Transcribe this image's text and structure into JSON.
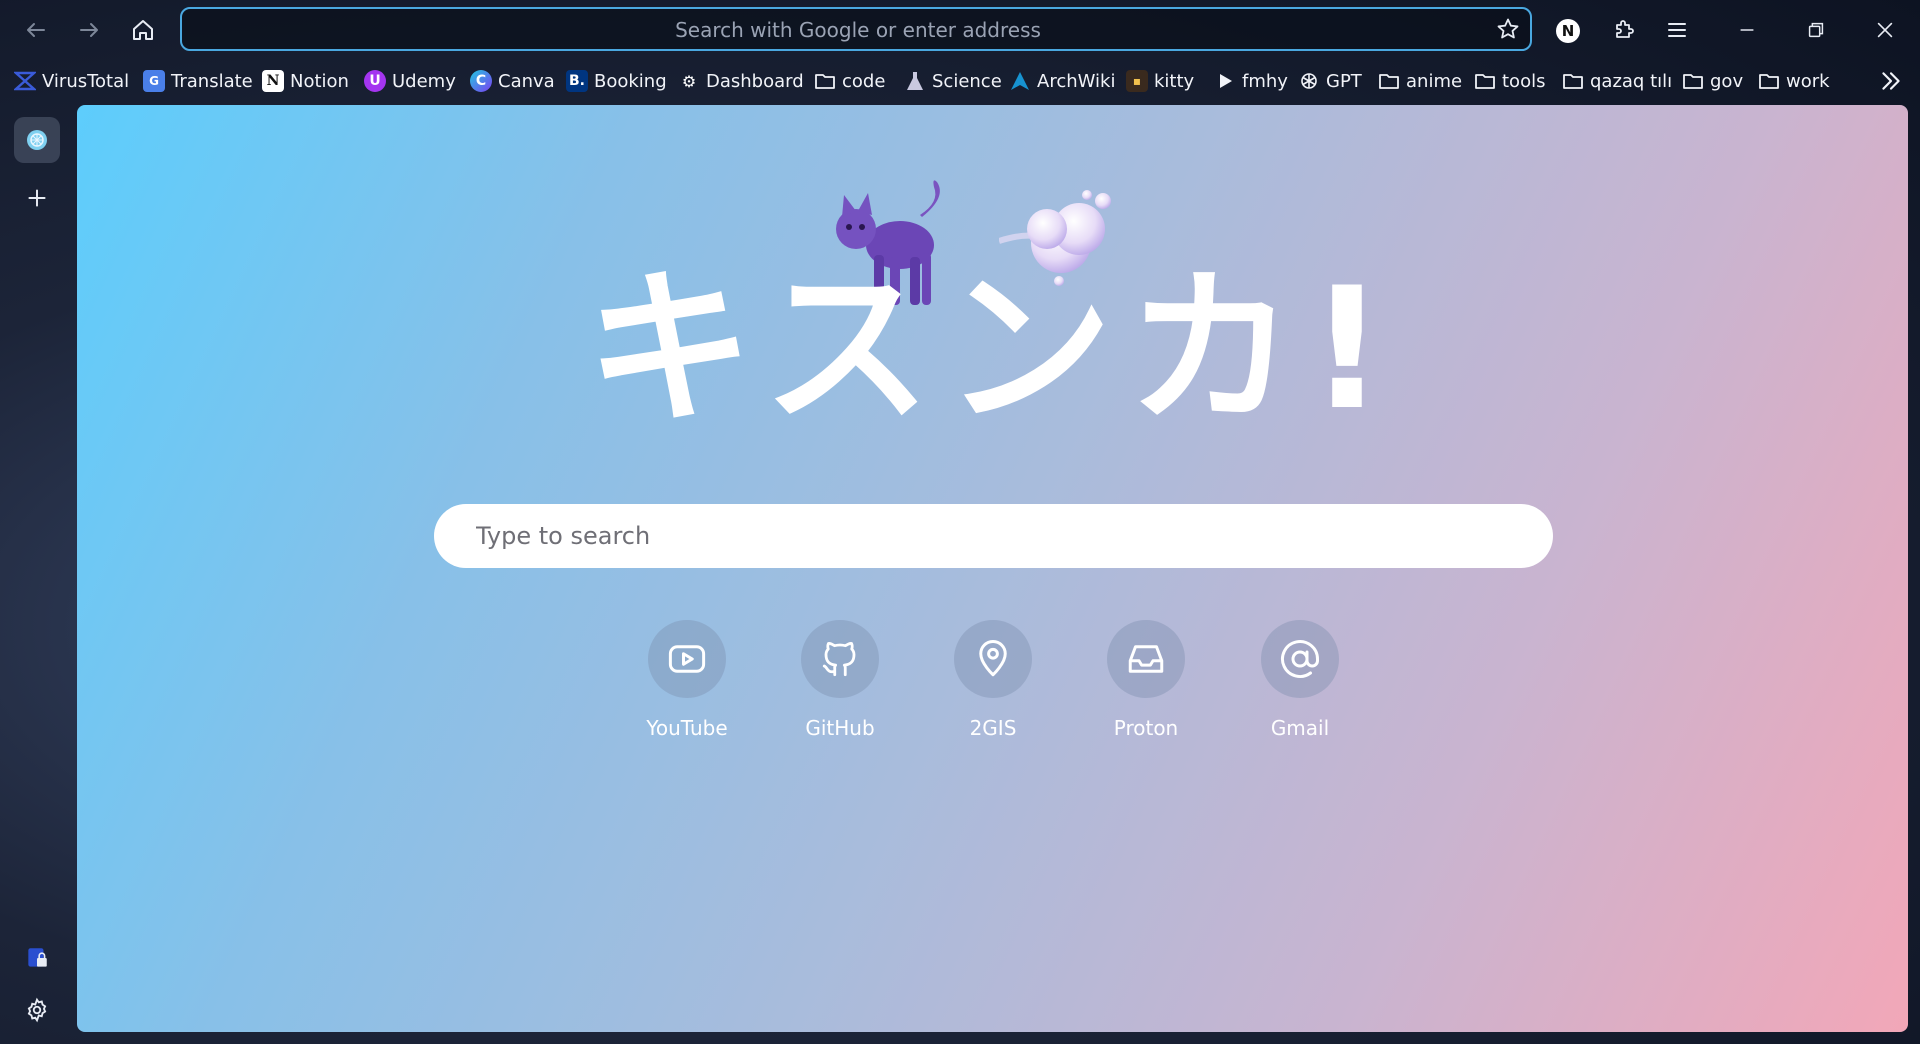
{
  "toolbar": {
    "back_icon": "arrow-left-icon",
    "forward_icon": "arrow-right-icon",
    "home_icon": "home-icon",
    "url_placeholder": "Search with Google or enter address",
    "profile_initial": "N"
  },
  "bookmarks": [
    {
      "label": "VirusTotal",
      "icon": "virustotal-icon"
    },
    {
      "label": "Translate",
      "icon": "translate-icon"
    },
    {
      "label": "Notion",
      "icon": "notion-icon"
    },
    {
      "label": "Udemy",
      "icon": "udemy-icon"
    },
    {
      "label": "Canva",
      "icon": "canva-icon"
    },
    {
      "label": "Booking",
      "icon": "booking-icon"
    },
    {
      "label": "Dashboard",
      "icon": "dashboard-icon"
    },
    {
      "label": "code",
      "icon": "folder-icon"
    },
    {
      "label": "Science",
      "icon": "flask-icon"
    },
    {
      "label": "ArchWiki",
      "icon": "arch-icon"
    },
    {
      "label": "kitty",
      "icon": "kitty-icon"
    },
    {
      "label": "fmhy",
      "icon": "play-icon"
    },
    {
      "label": "GPT",
      "icon": "openai-icon"
    },
    {
      "label": "anime",
      "icon": "folder-icon"
    },
    {
      "label": "tools",
      "icon": "folder-icon"
    },
    {
      "label": "qazaq tılı",
      "icon": "folder-icon"
    },
    {
      "label": "gov",
      "icon": "folder-icon"
    },
    {
      "label": "work",
      "icon": "folder-icon"
    }
  ],
  "page": {
    "title": "キスンカ!",
    "search_placeholder": "Type to search",
    "shortcuts": [
      {
        "label": "YouTube",
        "icon": "youtube-icon"
      },
      {
        "label": "GitHub",
        "icon": "github-icon"
      },
      {
        "label": "2GIS",
        "icon": "map-pin-icon"
      },
      {
        "label": "Proton",
        "icon": "inbox-icon"
      },
      {
        "label": "Gmail",
        "icon": "at-sign-icon"
      }
    ]
  },
  "colors": {
    "accent": "#4aa8e0",
    "gradient_start": "#5dcdfc",
    "gradient_end": "#f2a7b8"
  }
}
